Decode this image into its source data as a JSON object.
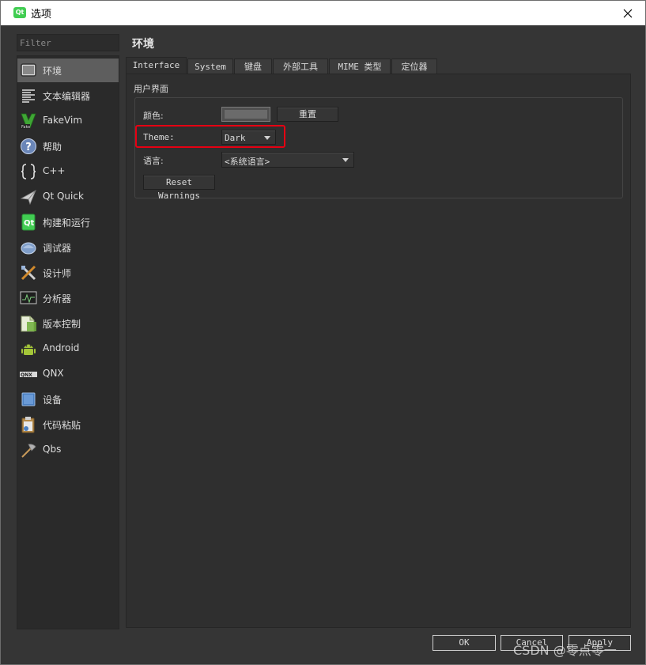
{
  "window": {
    "app_icon_text": "Qt",
    "title": "选项"
  },
  "filter": {
    "placeholder": "Filter"
  },
  "sidebar": {
    "items": [
      {
        "label": "环境",
        "icon": "environment-icon",
        "selected": true
      },
      {
        "label": "文本编辑器",
        "icon": "text-editor-icon"
      },
      {
        "label": "FakeVim",
        "icon": "fakevim-icon"
      },
      {
        "label": "帮助",
        "icon": "help-icon"
      },
      {
        "label": "C++",
        "icon": "cpp-icon"
      },
      {
        "label": "Qt Quick",
        "icon": "qt-quick-icon"
      },
      {
        "label": "构建和运行",
        "icon": "build-run-icon"
      },
      {
        "label": "调试器",
        "icon": "debugger-icon"
      },
      {
        "label": "设计师",
        "icon": "designer-icon"
      },
      {
        "label": "分析器",
        "icon": "analyzer-icon"
      },
      {
        "label": "版本控制",
        "icon": "version-control-icon"
      },
      {
        "label": "Android",
        "icon": "android-icon"
      },
      {
        "label": "QNX",
        "icon": "qnx-icon"
      },
      {
        "label": "设备",
        "icon": "devices-icon"
      },
      {
        "label": "代码粘贴",
        "icon": "code-paste-icon"
      },
      {
        "label": "Qbs",
        "icon": "qbs-icon"
      }
    ]
  },
  "main": {
    "page_title": "环境",
    "tabs": [
      {
        "label": "Interface",
        "active": true
      },
      {
        "label": "System"
      },
      {
        "label": "键盘"
      },
      {
        "label": "外部工具"
      },
      {
        "label": "MIME 类型"
      },
      {
        "label": "定位器"
      }
    ],
    "group_title": "用户界面",
    "color_label": "颜色:",
    "reset_button": "重置",
    "theme_label": "Theme:",
    "theme_value": "Dark",
    "language_label": "语言:",
    "language_value": "<系统语言>",
    "reset_warnings_button": "Reset Warnings"
  },
  "buttons": {
    "ok": "OK",
    "cancel": "Cancel",
    "apply": "Apply"
  },
  "watermark": "CSDN @零点零一",
  "colors": {
    "highlight": "#e60012",
    "app_icon": "#41cd52"
  }
}
